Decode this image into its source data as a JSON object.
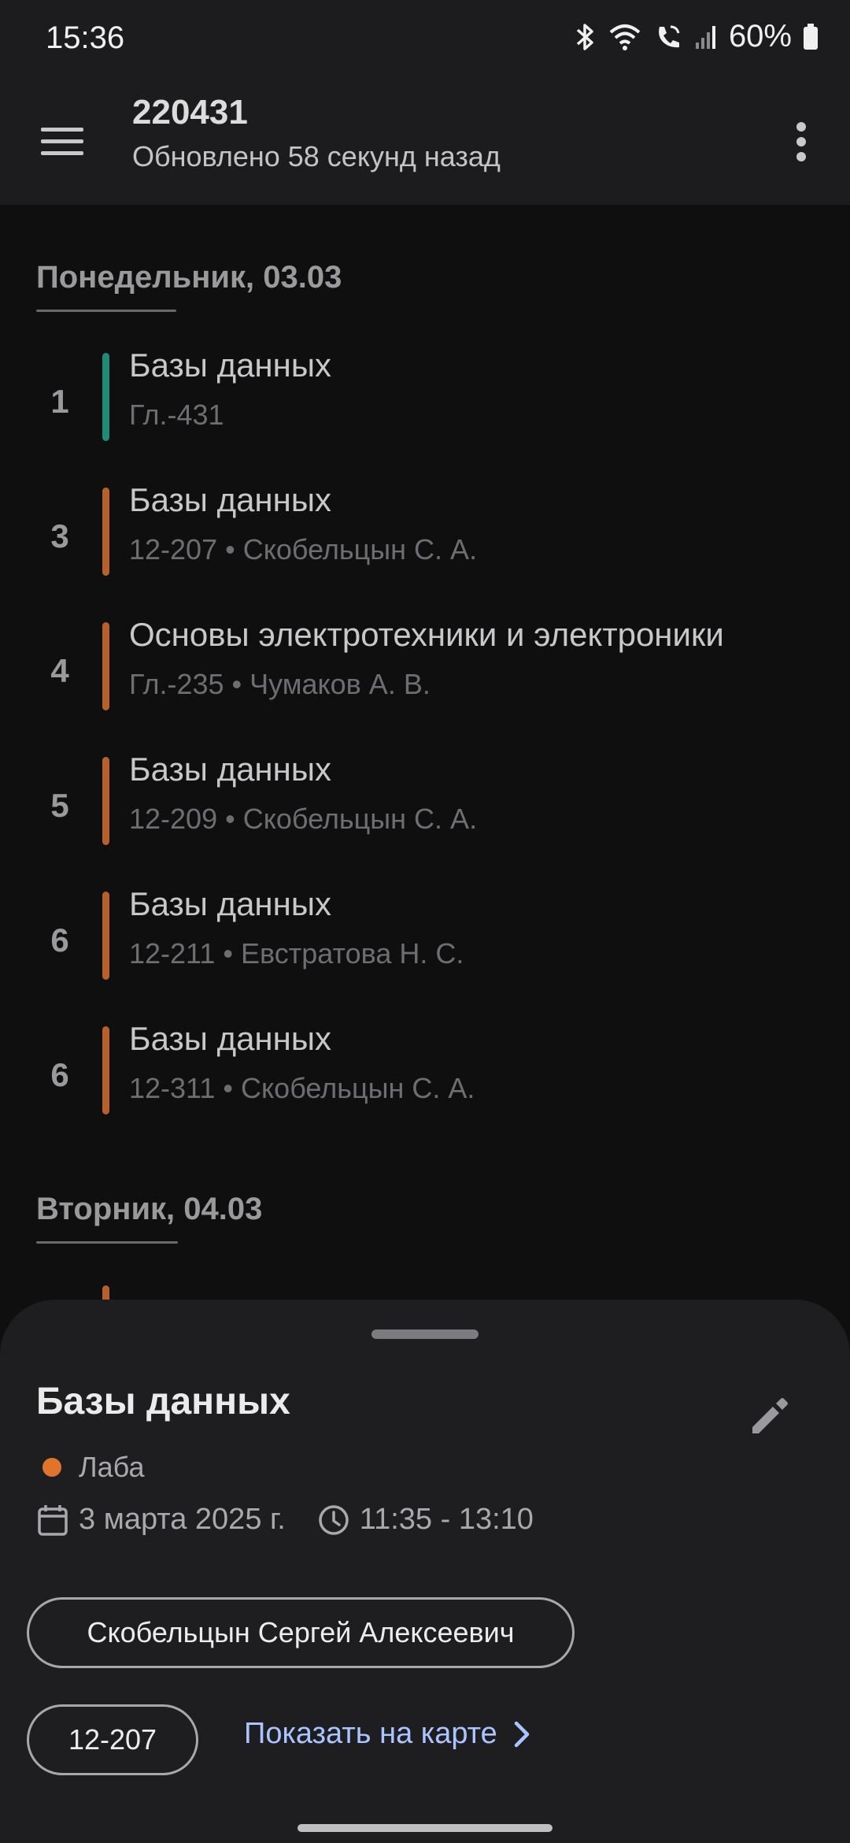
{
  "status_bar": {
    "time": "15:36",
    "battery": "60%"
  },
  "app_bar": {
    "title": "220431",
    "subtitle": "Обновлено 58 секунд назад"
  },
  "days": [
    {
      "header": "Понедельник, 03.03",
      "lessons": [
        {
          "number": "1",
          "title": "Базы данных",
          "meta": "Гл.-431",
          "color": "#1f8a75"
        },
        {
          "number": "3",
          "title": "Базы данных",
          "meta": "12-207 • Скобельцын С. А.",
          "color": "#b8602a"
        },
        {
          "number": "4",
          "title": "Основы электротехники и электроники",
          "meta": "Гл.-235 • Чумаков А. В.",
          "color": "#b8602a"
        },
        {
          "number": "5",
          "title": "Базы данных",
          "meta": "12-209 • Скобельцын С. А.",
          "color": "#b8602a"
        },
        {
          "number": "6",
          "title": "Базы данных",
          "meta": "12-211 • Евстратова Н. С.",
          "color": "#b8602a"
        },
        {
          "number": "6",
          "title": "Базы данных",
          "meta": "12-311 • Скобельцын С. А.",
          "color": "#b8602a"
        }
      ]
    },
    {
      "header": "Вторник, 04.03"
    }
  ],
  "sheet": {
    "title": "Базы данных",
    "type_label": "Лаба",
    "type_color": "#e0742c",
    "date": "3 марта 2025 г.",
    "time": "11:35 - 13:10",
    "teacher": "Скобельцын Сергей Алексеевич",
    "room": "12-207",
    "map_link": "Показать на карте"
  },
  "icons": {
    "menu": "hamburger-menu-icon",
    "more": "more-vert-icon",
    "edit": "pencil-icon",
    "calendar": "calendar-icon",
    "clock": "clock-icon",
    "chevron": "chevron-right-icon"
  }
}
